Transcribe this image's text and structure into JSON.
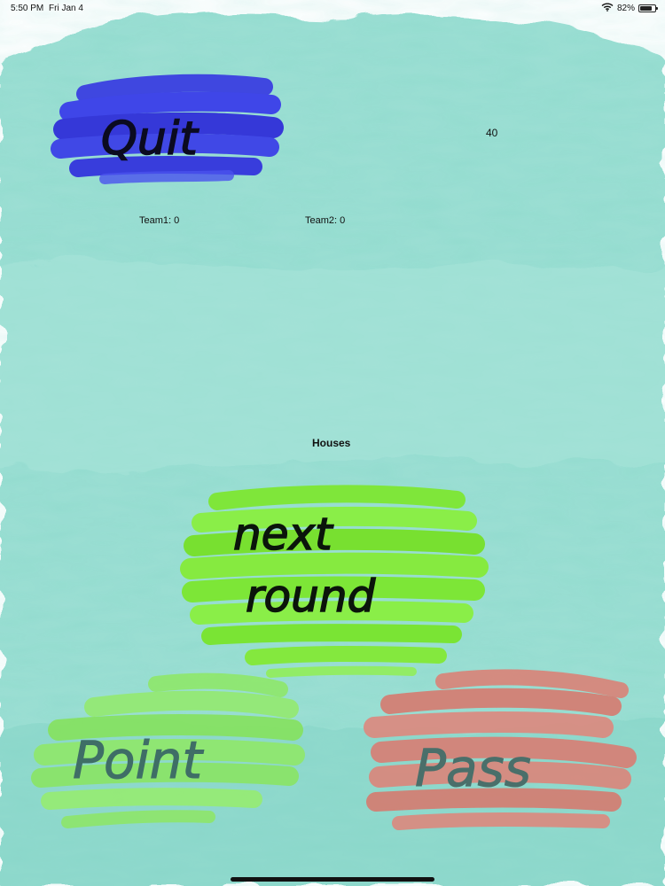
{
  "status_bar": {
    "time": "5:50 PM",
    "date": "Fri Jan 4",
    "battery": "82%",
    "battery_level": 0.82,
    "wifi_icon": "wifi-icon",
    "battery_icon": "battery-icon"
  },
  "game": {
    "timer": "40",
    "team1_score": "Team1: 0",
    "team2_score": "Team2: 0",
    "current_word": "Houses"
  },
  "buttons": {
    "quit": "Quit",
    "next_round_line1": "next",
    "next_round_line2": "round",
    "point": "Point",
    "pass": "Pass"
  },
  "colors": {
    "background": "#8fdcd0",
    "quit": "#3a3ee0",
    "next_round": "#7fe63a",
    "point": "#8fe86a",
    "pass": "#d9857a",
    "point_text": "#3f6e66",
    "pass_text": "#4a6f6a"
  }
}
